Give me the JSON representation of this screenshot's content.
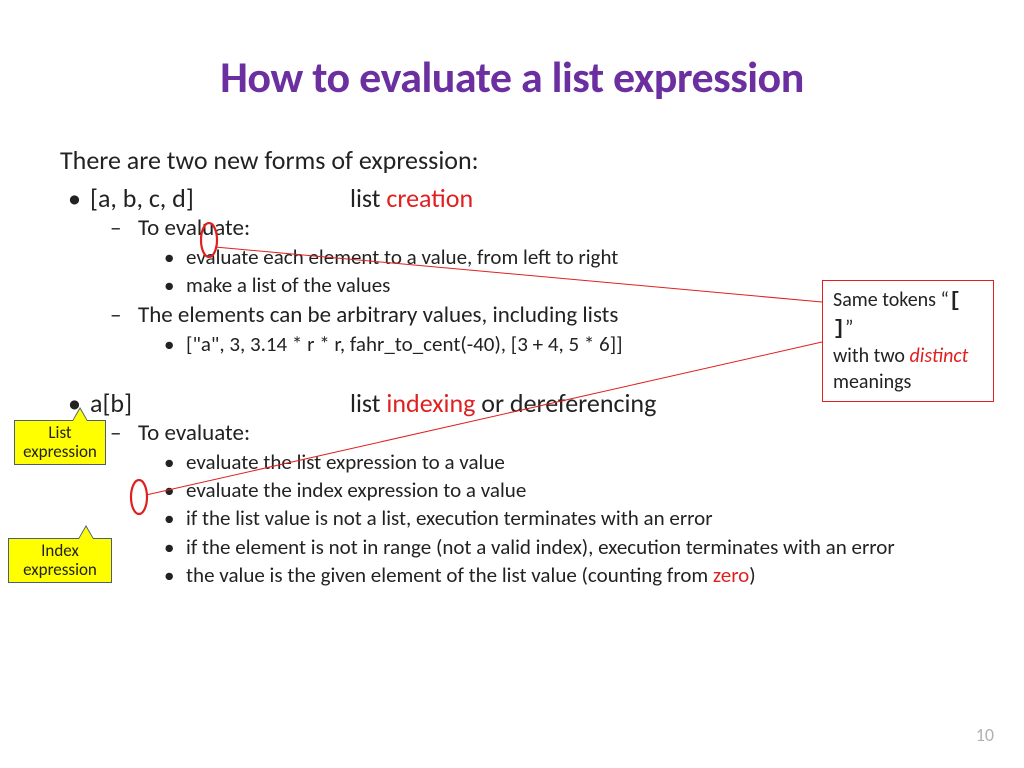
{
  "title": "How to evaluate a list expression",
  "intro": "There are two new forms of expression:",
  "b1": {
    "expr": "[a, b, c, d]",
    "label_pre": "list ",
    "label_red": "creation",
    "eval_h": "To evaluate:",
    "s1": "evaluate each element to a value, from left to right",
    "s2": "make a list of the values",
    "arb": "The elements can be arbitrary values, including lists",
    "ex": "[\"a\", 3, 3.14 * r * r, fahr_to_cent(-40), [3 + 4, 5 * 6]]"
  },
  "b2": {
    "expr": "a[b]",
    "label_pre": "list ",
    "label_red": "indexing",
    "label_post": " or dereferencing",
    "eval_h": "To evaluate:",
    "s1": "evaluate the list expression to a value",
    "s2": "evaluate the index expression to a value",
    "s3": "if the list value is not a list, execution terminates with an error",
    "s4": "if the element is not in range (not a valid index), execution terminates with an error",
    "s5_pre": "the value is the given element of the list value (counting from ",
    "s5_red": "zero",
    "s5_post": ")"
  },
  "box": {
    "l1a": "Same tokens “",
    "l1b": "[ ]",
    "l1c": "”",
    "l2a": "with two ",
    "l2b": "distinct",
    "l3": "meanings"
  },
  "tag1": {
    "l1": "List",
    "l2": "expression"
  },
  "tag2": {
    "l1": "Index",
    "l2": "expression"
  },
  "pgnum": "10"
}
